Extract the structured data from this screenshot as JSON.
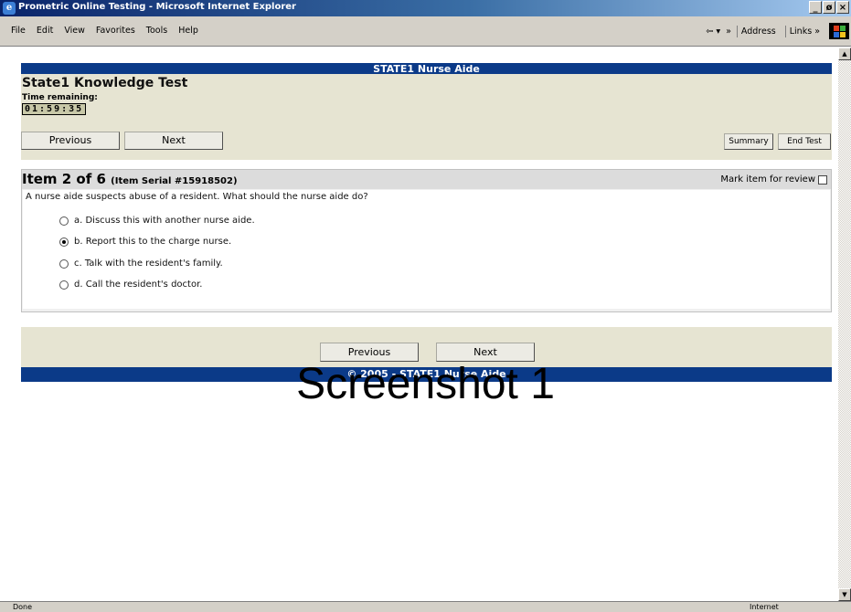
{
  "window": {
    "title": "Prometric Online Testing - Microsoft Internet Explorer",
    "controls": {
      "minimize": "_",
      "maximize": "ø",
      "close": "×"
    }
  },
  "menubar": {
    "items": [
      "File",
      "Edit",
      "View",
      "Favorites",
      "Tools",
      "Help"
    ],
    "address_label": "Address",
    "links_label": "Links",
    "more_glyph": "»"
  },
  "exam": {
    "banner": "STATE1 Nurse Aide",
    "test_title": "State1 Knowledge Test",
    "time_label": "Time remaining:",
    "time_value": "01:59:35",
    "nav": {
      "previous": "Previous",
      "next": "Next",
      "summary": "Summary",
      "end_test": "End Test"
    }
  },
  "item": {
    "title": "Item 2 of 6",
    "serial": "(Item Serial #15918502)",
    "mark_review": "Mark item for review",
    "question": "A nurse aide suspects abuse of a resident. What should the nurse aide do?",
    "options": [
      {
        "text": "a. Discuss this with another nurse aide.",
        "selected": false
      },
      {
        "text": "b. Report this to the charge nurse.",
        "selected": true
      },
      {
        "text": "c. Talk with the resident's family.",
        "selected": false
      },
      {
        "text": "d. Call the resident's doctor.",
        "selected": false
      }
    ]
  },
  "footer": {
    "previous": "Previous",
    "next": "Next",
    "copyright": "© 2005 - STATE1 Nurse Aide"
  },
  "watermark": "Screenshot 1",
  "statusbar": {
    "status": "Done",
    "zone": "Internet"
  },
  "colors": {
    "banner": "#0b3a88",
    "panel": "#e6e4d2",
    "titlebar": "#0a246a"
  }
}
